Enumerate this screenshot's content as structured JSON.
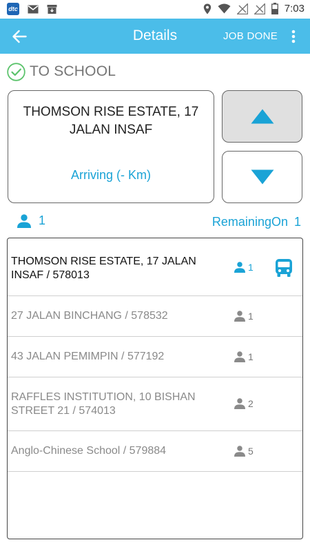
{
  "status_bar": {
    "app_badge": "dtc",
    "time": "7:03",
    "icons": [
      "app-badge-icon",
      "gmail-icon",
      "download-tray-icon",
      "location-icon",
      "wifi-icon",
      "no-signal-icon",
      "no-signal-icon",
      "battery-icon"
    ]
  },
  "app_bar": {
    "title": "Details",
    "action_label": "JOB DONE",
    "icons": [
      "back-arrow-icon",
      "more-vertical-icon"
    ],
    "color": "#4bbde9"
  },
  "route": {
    "title": "TO SCHOOL",
    "status_icon": "check-circle-icon",
    "status_color": "#5cc36c"
  },
  "current_stop": {
    "address": "THOMSON RISE ESTATE, 17 JALAN INSAF",
    "arriving": "Arriving (- Km)"
  },
  "navigation": {
    "up_icon": "triangle-up-icon",
    "down_icon": "triangle-down-icon",
    "accent": "#1aa3d6"
  },
  "summary": {
    "passenger_count": "1",
    "remaining_label": "RemainingOn",
    "remaining_count": "1"
  },
  "stops": [
    {
      "label": "THOMSON RISE ESTATE, 17 JALAN INSAF / 578013",
      "pax": "1",
      "active": true,
      "bus": true
    },
    {
      "label": "27 JALAN BINCHANG / 578532",
      "pax": "1",
      "active": false,
      "bus": false
    },
    {
      "label": "43 JALAN PEMIMPIN / 577192",
      "pax": "1",
      "active": false,
      "bus": false
    },
    {
      "label": "RAFFLES INSTITUTION, 10 BISHAN STREET 21 / 574013",
      "pax": "2",
      "active": false,
      "bus": false
    },
    {
      "label": "Anglo-Chinese School / 579884",
      "pax": "5",
      "active": false,
      "bus": false
    }
  ]
}
